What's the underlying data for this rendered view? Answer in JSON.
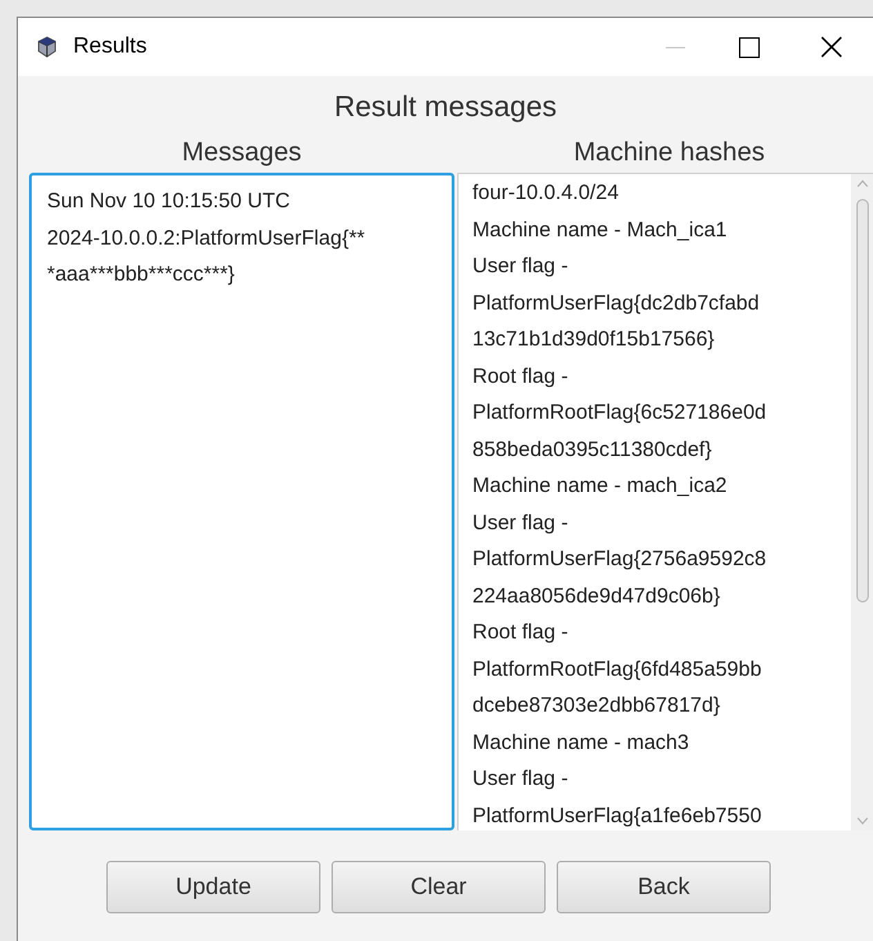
{
  "window": {
    "title": "Results"
  },
  "heading": "Result messages",
  "messages": {
    "label": "Messages",
    "lines": [
      "Sun Nov 10 10:15:50 UTC",
      "2024-10.0.0.2:PlatformUserFlag{**",
      "*aaa***bbb***ccc***}"
    ],
    "focused": true
  },
  "machine_hashes": {
    "label": "Machine hashes",
    "lines": [
      "four-10.0.4.0/24",
      "Machine name - Mach_ica1",
      "User flag -",
      "PlatformUserFlag{dc2db7cfabd",
      "13c71b1d39d0f15b17566}",
      "Root flag -",
      "PlatformRootFlag{6c527186e0d",
      "858beda0395c11380cdef}",
      "Machine name - mach_ica2",
      "User flag -",
      "PlatformUserFlag{2756a9592c8",
      "224aa8056de9d47d9c06b}",
      "Root flag -",
      "PlatformRootFlag{6fd485a59bb",
      "dcebe87303e2dbb67817d}",
      "Machine name - mach3",
      "User flag -",
      "PlatformUserFlag{a1fe6eb7550"
    ]
  },
  "buttons": [
    "Update",
    "Clear",
    "Back"
  ]
}
